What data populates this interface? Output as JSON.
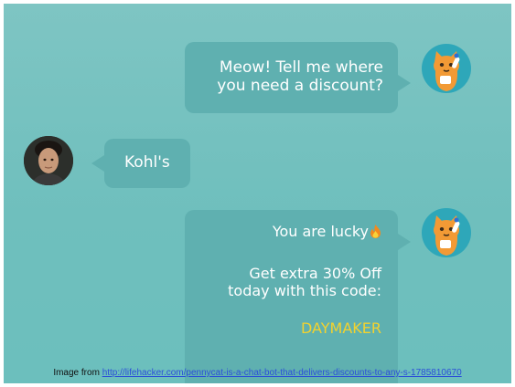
{
  "chat": {
    "messages": [
      {
        "sender": "bot",
        "lines": [
          "Meow! Tell me where",
          "you need a discount?"
        ]
      },
      {
        "sender": "user",
        "text": "Kohl's"
      },
      {
        "sender": "bot",
        "lucky": "You are lucky",
        "offer_lines": [
          "Get extra 30% Off",
          "today with this code:"
        ],
        "code": "DAYMAKER"
      }
    ]
  },
  "caption": {
    "prefix": "Image from ",
    "link": "http://lifehacker.com/pennycat-is-a-chat-bot-that-delivers-discounts-to-any-s-1785810670"
  },
  "colors": {
    "background": "#74c2c0",
    "bubble": "#5fb0b0",
    "code_highlight": "#f2d22e",
    "cat_avatar_bg": "#2ea7b9",
    "cat_orange": "#f29a35",
    "link": "#2b4fd8"
  },
  "icons": {
    "bot_avatar": "orange-cat-avatar-icon",
    "user_avatar": "user-photo-avatar",
    "emoji": "fire-emoji-icon"
  }
}
